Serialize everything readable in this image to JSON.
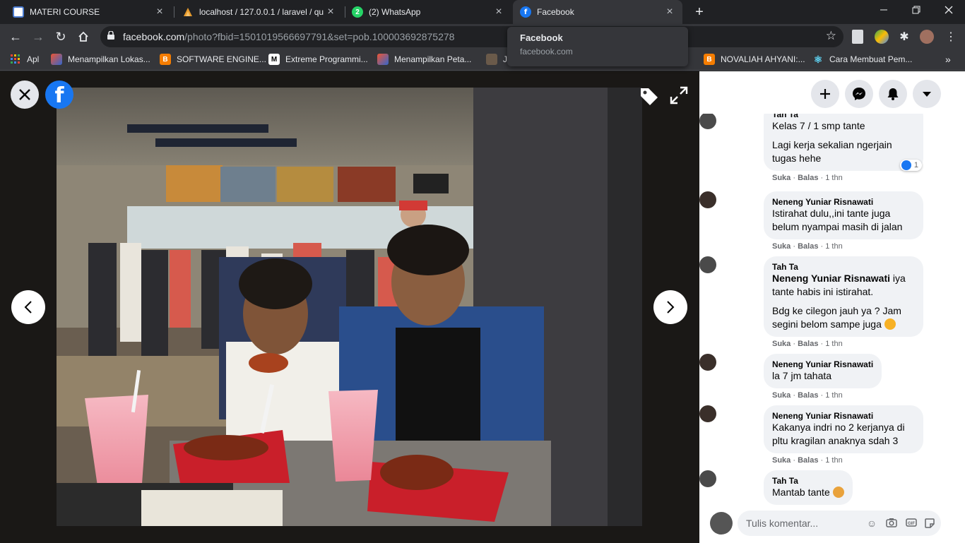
{
  "tabs": [
    {
      "title": "MATERI COURSE",
      "icon": "course-icon"
    },
    {
      "title": "localhost / 127.0.0.1 / laravel / qu",
      "icon": "phpmyadmin-icon"
    },
    {
      "title": "(2) WhatsApp",
      "icon": "whatsapp-icon",
      "badge": "2"
    },
    {
      "title": "Facebook",
      "icon": "facebook-icon"
    }
  ],
  "address": {
    "domain": "facebook.com",
    "path": "/photo?fbid=1501019566697791&set=pob.100003692875278"
  },
  "tooltip": {
    "title": "Facebook",
    "url": "facebook.com"
  },
  "bookmarks": [
    {
      "label": "Apl",
      "icon": "apps-grid-icon"
    },
    {
      "label": "Menampilkan Lokas...",
      "icon": "site-icon"
    },
    {
      "label": "SOFTWARE ENGINE...",
      "icon": "blogger-icon"
    },
    {
      "label": "Extreme Programmi...",
      "icon": "medium-icon"
    },
    {
      "label": "Menampilkan Peta...",
      "icon": "site-icon"
    },
    {
      "label": "Ja",
      "icon": "image-icon"
    },
    {
      "label": "NOVALIAH AHYANI:...",
      "icon": "blogger-icon"
    },
    {
      "label": "Cara Membuat Pem...",
      "icon": "atom-icon"
    },
    {
      "label": "»",
      "icon": "more-icon"
    }
  ],
  "comments": [
    {
      "name": "Tah Ta",
      "lines": [
        "Kelas 7 / 1 smp tante",
        "",
        "Lagi kerja sekalian ngerjain",
        "tugas hehe"
      ],
      "like": "Suka",
      "reply": "Balas",
      "time": "1 thn",
      "reaction_count": "1"
    },
    {
      "name": "Neneng Yuniar Risnawati",
      "lines": [
        "Istirahat dulu,,ini tante juga",
        "belum nyampai masih di jalan"
      ],
      "like": "Suka",
      "reply": "Balas",
      "time": "1 thn"
    },
    {
      "name": "Tah Ta",
      "mention": "Neneng Yuniar Risnawati",
      "lines": [
        "iya",
        "tante habis ini istirahat.",
        "",
        "Bdg ke cilegon jauh ya ? Jam",
        "segini belom sampe juga"
      ],
      "like": "Suka",
      "reply": "Balas",
      "time": "1 thn"
    },
    {
      "name": "Neneng Yuniar Risnawati",
      "lines": [
        "la 7 jm tahata"
      ],
      "like": "Suka",
      "reply": "Balas",
      "time": "1 thn"
    },
    {
      "name": "Neneng Yuniar Risnawati",
      "lines": [
        "Kakanya indri no 2 kerjanya di",
        "pltu kragilan anaknya sdah 3"
      ],
      "like": "Suka",
      "reply": "Balas",
      "time": "1 thn"
    },
    {
      "name": "Tah Ta",
      "lines": [
        "Mantab tante"
      ]
    }
  ],
  "composer": {
    "placeholder": "Tulis komentar..."
  },
  "colors": {
    "facebook_blue": "#1877f2",
    "chrome_dark": "#202124",
    "chrome_toolbar": "#35363a",
    "bubble": "#f0f2f5"
  }
}
